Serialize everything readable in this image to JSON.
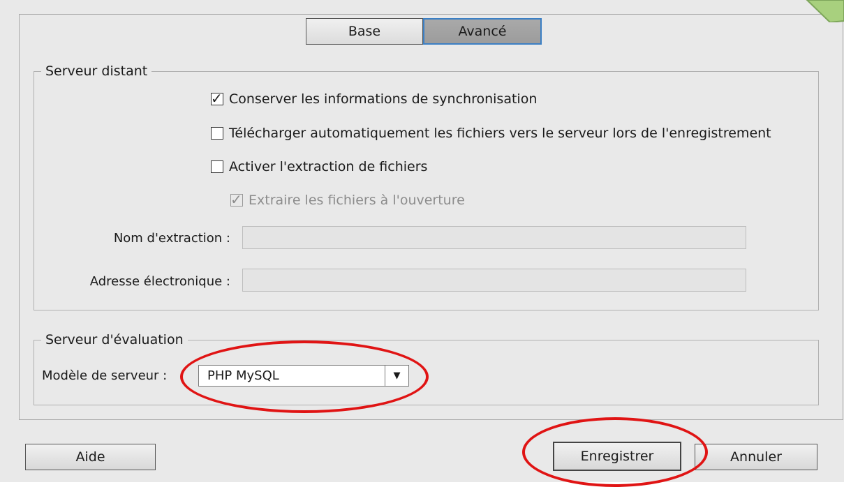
{
  "tabs": {
    "base_label": "Base",
    "advanced_label": "Avancé"
  },
  "remote_server": {
    "legend": "Serveur distant",
    "keep_sync_label": "Conserver les informations de synchronisation",
    "keep_sync_checked": true,
    "auto_upload_label": "Télécharger automatiquement les fichiers vers le serveur lors de l'enregistrement",
    "auto_upload_checked": false,
    "enable_checkout_label": "Activer l'extraction de fichiers",
    "enable_checkout_checked": false,
    "checkout_on_open_label": "Extraire les fichiers à l'ouverture",
    "checkout_on_open_checked": true,
    "checkout_name_label": "Nom d'extraction :",
    "checkout_name_value": "",
    "email_label": "Adresse électronique :",
    "email_value": ""
  },
  "testing_server": {
    "legend": "Serveur d'évaluation",
    "server_model_label": "Modèle de serveur :",
    "server_model_value": "PHP MySQL"
  },
  "footer": {
    "help_label": "Aide",
    "save_label": "Enregistrer",
    "cancel_label": "Annuler"
  },
  "colors": {
    "annotation": "#e01414",
    "accent": "#3b7fc4",
    "corner_shape": "#a8d07e"
  }
}
